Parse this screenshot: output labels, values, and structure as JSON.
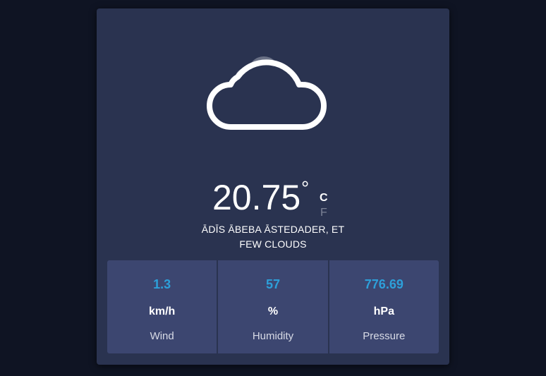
{
  "weather": {
    "icon": "few-clouds-icon",
    "temperature": "20.75",
    "degree_symbol": "°",
    "unit_c": "C",
    "unit_f": "F",
    "location": "ĀDĪS ĀBEBA ĀSTEDADER, ET",
    "condition": "FEW CLOUDS"
  },
  "stats": [
    {
      "value": "1.3",
      "unit": "km/h",
      "label": "Wind"
    },
    {
      "value": "57",
      "unit": "%",
      "label": "Humidity"
    },
    {
      "value": "776.69",
      "unit": "hPa",
      "label": "Pressure"
    }
  ],
  "colors": {
    "background": "#0f1423",
    "card": "#2a3350",
    "stats_panel": "#3c4670",
    "accent": "#2d9fd9"
  }
}
